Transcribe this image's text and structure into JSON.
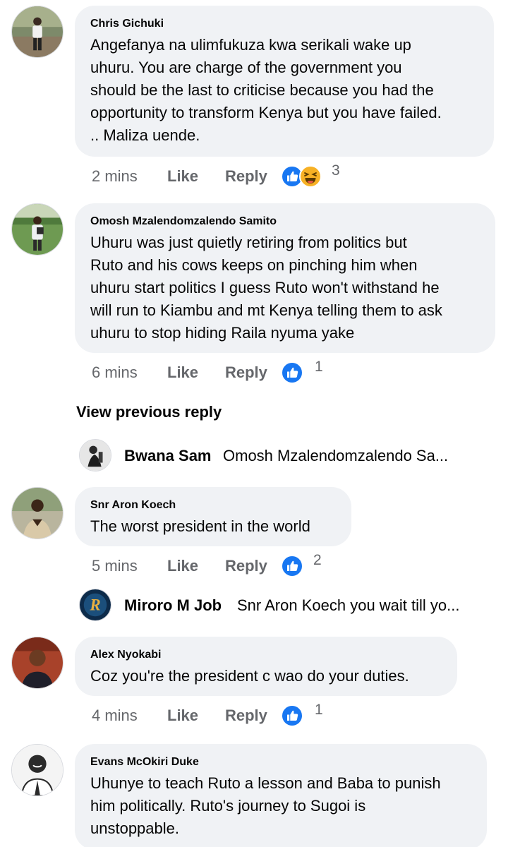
{
  "comments": [
    {
      "author": "Chris Gichuki",
      "lines": [
        "Angefanya na ulimfukuza kwa serikali wake up",
        "uhuru. You are charge of the government you",
        "should be the last to criticise because you had the",
        "opportunity to transform Kenya but you have failed.",
        ".. Maliza uende."
      ],
      "time": "2 mins",
      "like_label": "Like",
      "reply_label": "Reply",
      "reactions": [
        "like-icon",
        "haha-icon"
      ],
      "reaction_count": "3"
    },
    {
      "author": "Omosh Mzalendomzalendo Samito",
      "lines": [
        "Uhuru was just quietly retiring from politics but",
        "Ruto and his cows keeps on pinching him when",
        "uhuru start politics I guess Ruto won't withstand he",
        "will run to Kiambu and mt Kenya telling them to ask",
        "uhuru to stop hiding Raila nyuma yake"
      ],
      "time": "6 mins",
      "like_label": "Like",
      "reply_label": "Reply",
      "reactions": [
        "like-icon"
      ],
      "reaction_count": "1"
    },
    {
      "author": "Snr Aron Koech",
      "lines": [
        "The worst president in the world"
      ],
      "time": "5 mins",
      "like_label": "Like",
      "reply_label": "Reply",
      "reactions": [
        "like-icon"
      ],
      "reaction_count": "2"
    },
    {
      "author": "Alex Nyokabi",
      "lines": [
        "Coz you're the president c wao do your duties."
      ],
      "time": "4 mins",
      "like_label": "Like",
      "reply_label": "Reply",
      "reactions": [
        "like-icon"
      ],
      "reaction_count": "1"
    },
    {
      "author": "Evans McOkiri Duke",
      "lines": [
        "Uhunye to teach Ruto a lesson and Baba to punish",
        "him politically. Ruto's journey to Sugoi is",
        "unstoppable."
      ]
    }
  ],
  "view_previous_reply": "View previous reply",
  "replies": [
    {
      "name": "Bwana Sam",
      "text": "Omosh Mzalendomzalendo Sa..."
    },
    {
      "name": "Miroro M Job",
      "text": "Snr Aron Koech you wait till yo..."
    }
  ],
  "colors": {
    "bubble_bg": "#f0f2f5",
    "meta_text": "#65676b",
    "like_blue": "#1877f2",
    "haha_yellow": "#f7b125"
  }
}
